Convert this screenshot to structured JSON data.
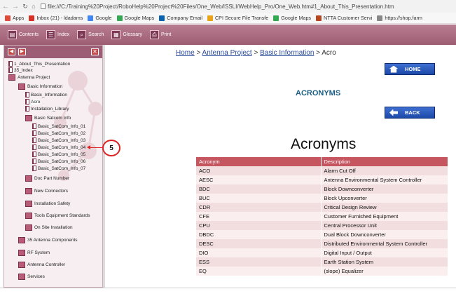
{
  "browser": {
    "url": "file:///C:/Training%20Project/RoboHelp%20Project%20Files/One_Web/ISSLI/WebHelp_Pro/One_Web.htm#1_About_This_Presentation.htm",
    "bookmarks": [
      {
        "label": "Apps",
        "icon": "apps-grid-icon",
        "color": "#e04a3a"
      },
      {
        "label": "Inbox (21) - ldadams",
        "icon": "gmail-icon",
        "color": "#d93025"
      },
      {
        "label": "Google",
        "icon": "google-icon",
        "color": "#4285f4"
      },
      {
        "label": "Google Maps",
        "icon": "maps-icon",
        "color": "#34a853"
      },
      {
        "label": "Company Email",
        "icon": "outlook-icon",
        "color": "#0a64ad"
      },
      {
        "label": "CPI Secure File Transfe",
        "icon": "file-transfer-icon",
        "color": "#e8a317"
      },
      {
        "label": "Google Maps",
        "icon": "maps-icon",
        "color": "#34a853"
      },
      {
        "label": "NTTA Customer Servi",
        "icon": "ntta-icon",
        "color": "#b5461f"
      },
      {
        "label": "https://shop.farm",
        "icon": "document-icon",
        "color": "#888888"
      }
    ]
  },
  "toolbar": {
    "contents": "Contents",
    "index": "Index",
    "search": "Search",
    "glossary": "Glossary",
    "print": "Print"
  },
  "tree": {
    "items": [
      {
        "label": "1_About_This_Presentation",
        "type": "page"
      },
      {
        "label": "35_Index",
        "type": "page"
      },
      {
        "label": "Antenna Project",
        "type": "book"
      },
      {
        "label": "Basic Information",
        "type": "book"
      },
      {
        "label": "Basic_Information",
        "type": "page"
      },
      {
        "label": "Acro",
        "type": "page"
      },
      {
        "label": "Installation_Library",
        "type": "page"
      },
      {
        "label": "Basic Satcom Info",
        "type": "book"
      },
      {
        "label": "Basic_SatCom_Info_01",
        "type": "page"
      },
      {
        "label": "Basic_SatCom_Info_02",
        "type": "page"
      },
      {
        "label": "Basic_SatCom_Info_03",
        "type": "page"
      },
      {
        "label": "Basic_SatCom_Info_04",
        "type": "page"
      },
      {
        "label": "Basic_SatCom_Info_05",
        "type": "page"
      },
      {
        "label": "Basic_SatCom_Info_06",
        "type": "page"
      },
      {
        "label": "Basic_SatCom_Info_07",
        "type": "page"
      },
      {
        "label": "Doc Part Number",
        "type": "book"
      },
      {
        "label": "New Connectors",
        "type": "book"
      },
      {
        "label": "Installation Safety",
        "type": "book"
      },
      {
        "label": "Tools Equipment Standards",
        "type": "book"
      },
      {
        "label": "On Site Installation",
        "type": "book"
      },
      {
        "label": "35 Antenna Components",
        "type": "book"
      },
      {
        "label": "RF System",
        "type": "book"
      },
      {
        "label": "Antenna Controller",
        "type": "book"
      },
      {
        "label": "Services",
        "type": "book"
      }
    ]
  },
  "main": {
    "breadcrumb": {
      "home": "Home",
      "sep1": " > ",
      "project": "Antenna Project",
      "sep2": " > ",
      "section": "Basic Information",
      "sep3": " > ",
      "current": "Acro"
    },
    "home_button": "HOME",
    "heading": "ACRONYMS",
    "back_button": "BACK",
    "title": "Acronyms",
    "table": {
      "headers": [
        "Acronym",
        "Description"
      ],
      "rows": [
        [
          "ACO",
          "Alarm Cut Off"
        ],
        [
          "AESC",
          "Antenna Environmental System Controller"
        ],
        [
          "BDC",
          "Block Downconverter"
        ],
        [
          "BUC",
          "Block Upconverter"
        ],
        [
          "CDR",
          "Critical Design Review"
        ],
        [
          "CFE",
          "Customer Furnished Equipment"
        ],
        [
          "CPU",
          "Central Processor Unit"
        ],
        [
          "DBDC",
          "Dual Block Downconverter"
        ],
        [
          "DESC",
          "Distributed Environmental System Controller"
        ],
        [
          "DIO",
          "Digital Input / Output"
        ],
        [
          "ESS",
          "Earth Station System"
        ],
        [
          "EQ",
          "(slope) Equalizer"
        ]
      ]
    }
  },
  "annotation": {
    "number": "5"
  }
}
